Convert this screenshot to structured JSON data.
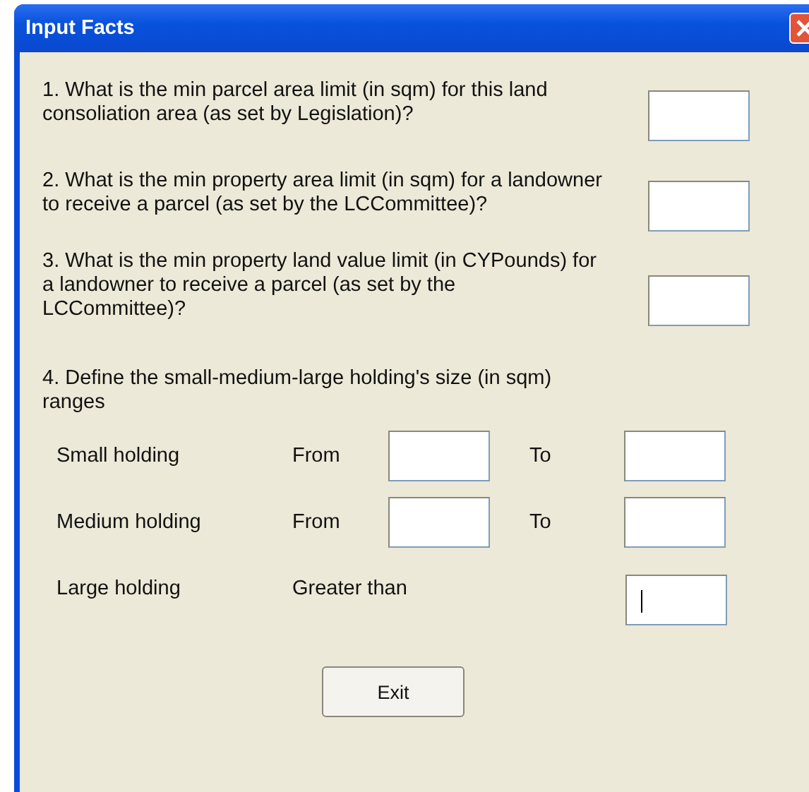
{
  "window": {
    "title": "Input Facts"
  },
  "questions": [
    {
      "text": "1. What is the min parcel area limit (in sqm) for this land consoliation area (as set by Legislation)?",
      "field": {
        "focused": false
      }
    },
    {
      "text": "2. What is the min property area limit (in sqm) for a landowner to receive a parcel (as set by the LCCommittee)?",
      "field": {
        "focused": false
      }
    },
    {
      "text": "3. What is the min property land value limit (in CYPounds) for a landowner to receive a parcel (as set by the LCCommittee)?",
      "field": {
        "focused": false
      }
    }
  ],
  "ranges_prompt": "4. Define the small-medium-large holding's size (in sqm) ranges",
  "holdings": [
    {
      "kind": "range",
      "label": "Small holding",
      "from_label": "From",
      "from_field": {
        "focused": false
      },
      "to_label": "To",
      "to_field": {
        "focused": false
      }
    },
    {
      "kind": "range",
      "label": "Medium holding",
      "from_label": "From",
      "from_field": {
        "focused": false
      },
      "to_label": "To",
      "to_field": {
        "focused": false
      }
    },
    {
      "kind": "open",
      "label": "Large holding",
      "from_label": "Greater than",
      "to_field": {
        "focused": true
      }
    }
  ],
  "buttons": [
    "Exit"
  ]
}
